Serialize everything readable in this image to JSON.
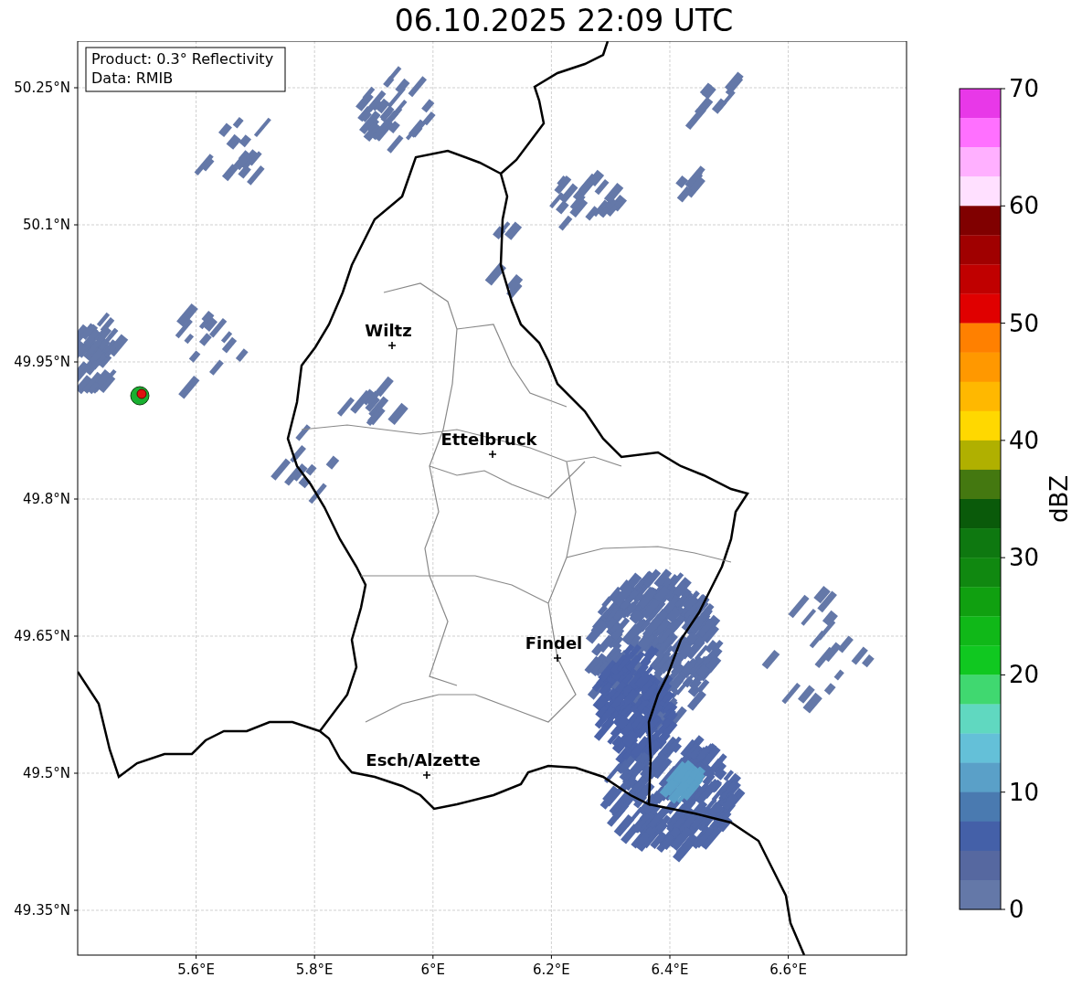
{
  "title": "06.10.2025 22:09 UTC",
  "info_box": {
    "lines": [
      "Product: 0.3° Reflectivity",
      "Data: RMIB"
    ]
  },
  "cities": [
    {
      "name": "Wiltz"
    },
    {
      "name": "Ettelbruck"
    },
    {
      "name": "Findel"
    },
    {
      "name": "Esch/Alzette"
    }
  ],
  "x_ticks": [
    "5.6°E",
    "5.8°E",
    "6°E",
    "6.2°E",
    "6.4°E",
    "6.6°E"
  ],
  "y_ticks": [
    "50.25°N",
    "50.1°N",
    "49.95°N",
    "49.8°N",
    "49.65°N",
    "49.5°N",
    "49.35°N"
  ],
  "colorbar": {
    "label": "dBZ",
    "ticks": [
      "70",
      "60",
      "50",
      "40",
      "30",
      "20",
      "10",
      "0"
    ],
    "steps": [
      {
        "color": "#e838e8"
      },
      {
        "color": "#ff70ff"
      },
      {
        "color": "#ffb0ff"
      },
      {
        "color": "#ffe0ff"
      },
      {
        "color": "#800000"
      },
      {
        "color": "#a00000"
      },
      {
        "color": "#c00000"
      },
      {
        "color": "#e00000"
      },
      {
        "color": "#ff8000"
      },
      {
        "color": "#ff9800"
      },
      {
        "color": "#ffb800"
      },
      {
        "color": "#ffd800"
      },
      {
        "color": "#b0b000"
      },
      {
        "color": "#447810"
      },
      {
        "color": "#0a5a0a"
      },
      {
        "color": "#0e7810"
      },
      {
        "color": "#108810"
      },
      {
        "color": "#10a010"
      },
      {
        "color": "#10b818"
      },
      {
        "color": "#10c820"
      },
      {
        "color": "#40d870"
      },
      {
        "color": "#60d8c0"
      },
      {
        "color": "#64c0d8"
      },
      {
        "color": "#5aa0c8"
      },
      {
        "color": "#4a7ab0"
      },
      {
        "color": "#4460a8"
      },
      {
        "color": "#5668a0"
      },
      {
        "color": "#6478a8"
      }
    ]
  }
}
